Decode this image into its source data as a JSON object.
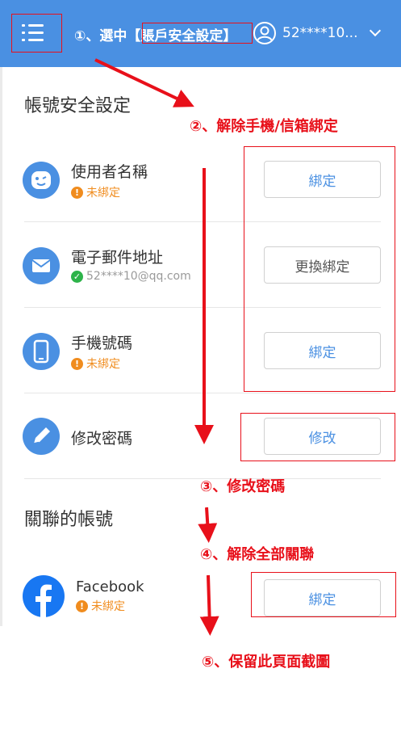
{
  "header": {
    "user_name": "52****10...",
    "annotation": "①、選中【賬戶安全設定】"
  },
  "security": {
    "title": "帳號安全設定",
    "annotation": "②、解除手機/信箱綁定",
    "rows": [
      {
        "label": "使用者名稱",
        "status": "未綁定",
        "button": "綁定"
      },
      {
        "label": "電子郵件地址",
        "status": "52****10@qq.com",
        "button": "更換綁定"
      },
      {
        "label": "手機號碼",
        "status": "未綁定",
        "button": "綁定"
      },
      {
        "label": "修改密碼",
        "button": "修改"
      }
    ]
  },
  "annotations": {
    "step3": "③、修改密碼",
    "step4": "④、解除全部關聯",
    "step5": "⑤、保留此頁面截圖"
  },
  "linked": {
    "title": "關聯的帳號",
    "rows": [
      {
        "label": "Facebook",
        "status": "未綁定",
        "button": "綁定"
      }
    ]
  },
  "colors": {
    "header_bg": "#4a90e2",
    "accent": "#4a90e2",
    "annotation": "#e8101a",
    "warning": "#f08c1e",
    "success": "#2db34a"
  }
}
